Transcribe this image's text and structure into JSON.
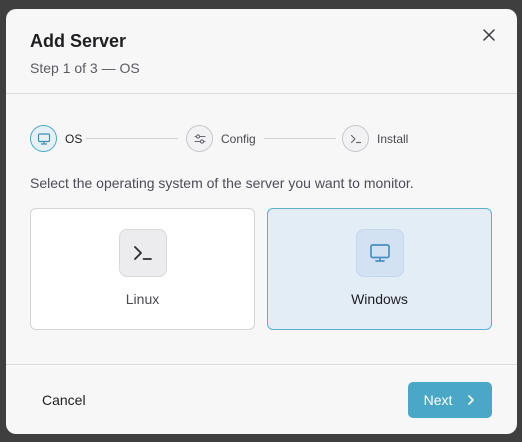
{
  "modal": {
    "title": "Add Server",
    "subtitle": "Step 1 of 3 — OS",
    "close_icon": "close-icon"
  },
  "stepper": {
    "steps": [
      {
        "label": "OS",
        "icon": "monitor-icon",
        "active": true
      },
      {
        "label": "Config",
        "icon": "sliders-icon",
        "active": false
      },
      {
        "label": "Install",
        "icon": "terminal-icon",
        "active": false
      }
    ]
  },
  "instruction": "Select the operating system of the server you want to monitor.",
  "os_options": [
    {
      "label": "Linux",
      "icon": "terminal-icon",
      "selected": false
    },
    {
      "label": "Windows",
      "icon": "monitor-icon",
      "selected": true
    }
  ],
  "footer": {
    "cancel_label": "Cancel",
    "next_label": "Next",
    "next_icon": "chevron-right-icon"
  },
  "colors": {
    "accent": "#4aa7c6",
    "selected_bg": "#e3edf6",
    "modal_bg": "#f7f7f8"
  }
}
